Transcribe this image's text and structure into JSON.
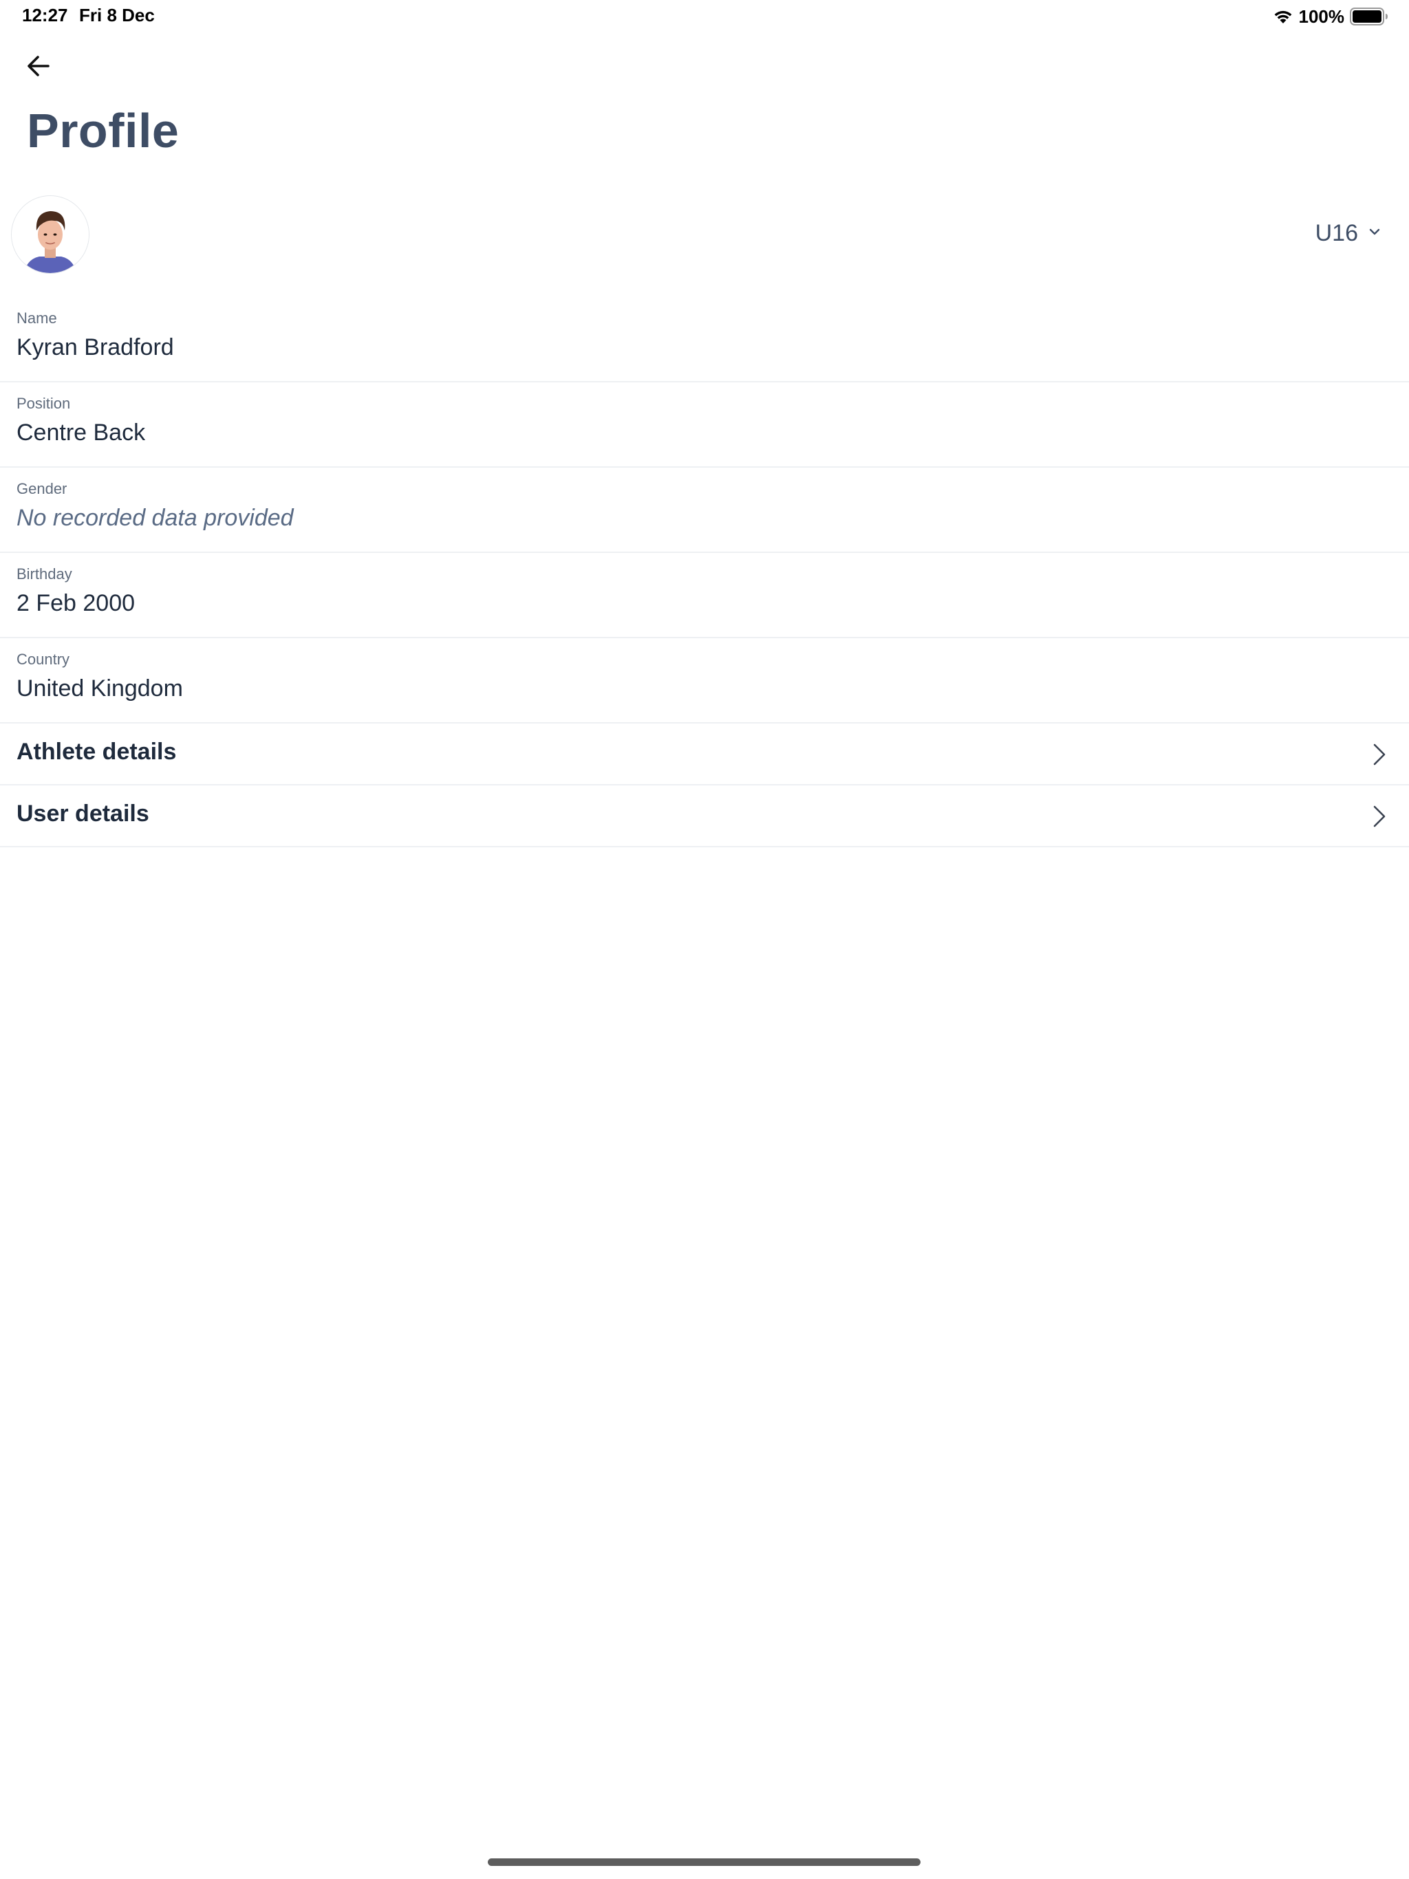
{
  "status_bar": {
    "time": "12:27",
    "date": "Fri 8 Dec",
    "battery_percent": "100%",
    "icons": [
      "wifi-icon",
      "battery-icon"
    ]
  },
  "header": {
    "back_icon": "arrow-left-icon",
    "title": "Profile"
  },
  "profile": {
    "avatar": "athlete-photo",
    "squad_selected": "U16",
    "squad_icon": "chevron-down-icon"
  },
  "fields": [
    {
      "label": "Name",
      "value": "Kyran Bradford",
      "empty": false
    },
    {
      "label": "Position",
      "value": "Centre Back",
      "empty": false
    },
    {
      "label": "Gender",
      "value": "No recorded data provided",
      "empty": true
    },
    {
      "label": "Birthday",
      "value": "2 Feb 2000",
      "empty": false
    },
    {
      "label": "Country",
      "value": "United Kingdom",
      "empty": false
    }
  ],
  "sections": [
    {
      "label": "Athlete details",
      "icon": "chevron-right-icon"
    },
    {
      "label": "User details",
      "icon": "chevron-right-icon"
    }
  ],
  "colors": {
    "title": "#3e4d65",
    "text": "#1e2a3c",
    "label": "#5f6b7c",
    "empty_value": "#5a6b85",
    "divider": "#eef0f3"
  }
}
